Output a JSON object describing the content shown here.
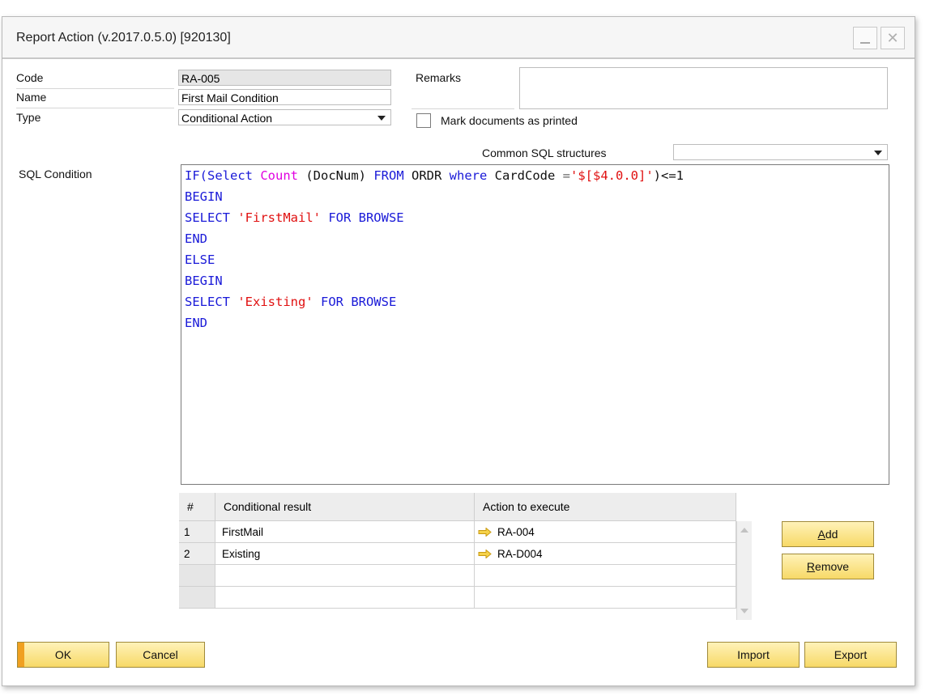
{
  "window": {
    "title": "Report Action (v.2017.0.5.0) [920130]",
    "close_glyph": "✕"
  },
  "form": {
    "code_label": "Code",
    "code_value": "RA-005",
    "name_label": "Name",
    "name_value": "First Mail Condition",
    "type_label": "Type",
    "type_value": "Conditional Action",
    "remarks_label": "Remarks",
    "remarks_value": "",
    "mark_printed_label": "Mark documents as printed",
    "mark_printed_checked": false,
    "common_sql_label": "Common SQL structures",
    "common_sql_value": "",
    "sql_condition_label": "SQL Condition"
  },
  "sql": {
    "line1": {
      "t1": "IF(",
      "t2": "Select",
      "t3": " ",
      "t4": "Count",
      "t5": " (DocNum) ",
      "t6": "FROM",
      "t7": " ORDR ",
      "t8": "where",
      "t9": " CardCode ",
      "t10": "=",
      "t11": "'$[$4.0.0]'",
      "t12": ")<=1"
    },
    "line2": "BEGIN",
    "line3": {
      "t1": "SELECT ",
      "t2": "'FirstMail'",
      "t3": " FOR BROWSE"
    },
    "line4": "END",
    "line5": "ELSE",
    "line6": "BEGIN",
    "line7": {
      "t1": "SELECT ",
      "t2": "'Existing'",
      "t3": " FOR BROWSE"
    },
    "line8": "END"
  },
  "grid": {
    "headers": {
      "num": "#",
      "result": "Conditional result",
      "action": "Action to execute"
    },
    "rows": [
      {
        "num": "1",
        "result": "FirstMail",
        "action": "RA-004"
      },
      {
        "num": "2",
        "result": "Existing",
        "action": "RA-D004"
      }
    ]
  },
  "buttons": {
    "add_prefix": "",
    "add_underlined": "A",
    "add_rest": "dd",
    "remove_underlined": "R",
    "remove_rest": "emove",
    "ok": "OK",
    "cancel": "Cancel",
    "import": "Import",
    "export": "Export"
  },
  "colors": {
    "keyword": "#1a1ad8",
    "function": "#e000e0",
    "string": "#e01010",
    "button_fill": "#f7d967",
    "ok_accent": "#f0a020"
  }
}
